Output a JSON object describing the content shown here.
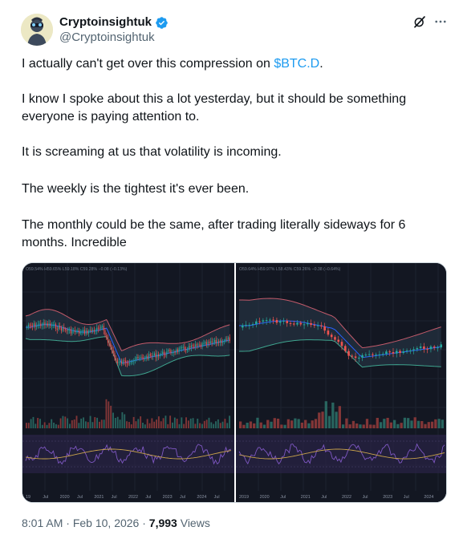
{
  "author": {
    "display_name": "Cryptoinsightuk",
    "handle": "@Cryptoinsightuk",
    "verified": true,
    "verified_color": "#1d9bf0"
  },
  "icons": {
    "grok": "grok-icon",
    "more": "more-icon"
  },
  "tweet": {
    "line1_prefix": "I actually can't get over this compression on ",
    "cashtag": "$BTC.D",
    "line1_suffix": ".",
    "para2": "I know I spoke about this a lot yesterday, but it should be something\neveryone is paying attention to.",
    "para3": "It is screaming at us that volatility is incoming.",
    "para4": "The weekly is the tightest it's ever been.",
    "para5": "The monthly could be the same, after trading literally sideways for 6\nmonths. Incredible",
    "cashtag_color": "#1d9bf0"
  },
  "media": {
    "left_chart": {
      "ohlc_label": "O59.54% H59.65% L59.18% C59.28% −0.08 (−0.13%)",
      "time_labels": [
        "19",
        "Jul",
        "2020",
        "Jul",
        "2021",
        "Jul",
        "2022",
        "Jul",
        "2023",
        "Jul",
        "2024",
        "Jul"
      ]
    },
    "right_chart": {
      "ohlc_label": "O59.64% H59.97% L58.43% C59.26% −0.38 (−0.64%)",
      "time_labels": [
        "2019",
        "2020",
        "Jul",
        "2021",
        "Jul",
        "2022",
        "Jul",
        "2023",
        "Jul",
        "2024"
      ]
    },
    "colors": {
      "background": "#131722",
      "up": "#26a69a",
      "down": "#ef5350",
      "band_fill": "#2a3b4a",
      "basis": "#2962ff",
      "rsi_line": "#7e57c2",
      "rsi_band": "#2a2446",
      "ma_line": "#c8a24b"
    }
  },
  "meta": {
    "time": "8:01 AM",
    "sep1": " · ",
    "date": "Feb 10, 2026",
    "sep2": " · ",
    "views_count": "7,993",
    "views_label": " Views"
  }
}
